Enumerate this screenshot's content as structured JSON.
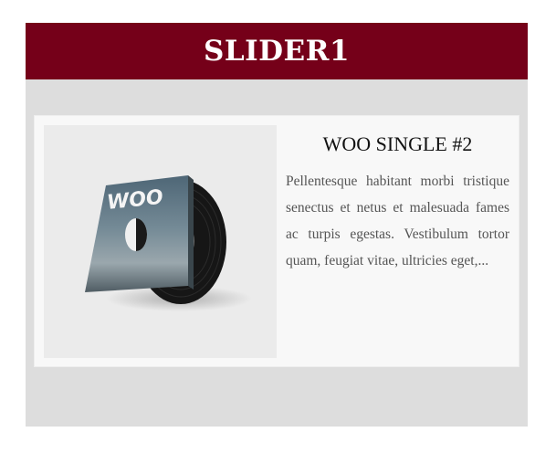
{
  "widget": {
    "title": "SLIDER1",
    "colors": {
      "header_bg": "#750019",
      "body_bg": "#dddddd",
      "slide_bg": "#f8f8f8"
    }
  },
  "slide": {
    "image": {
      "icon": "vinyl-record-album-image",
      "cover_text": "WOO"
    },
    "title": "WOO SINGLE #2",
    "excerpt": "Pellentesque habitant morbi tristique senectus et netus et malesuada fames ac turpis egestas. Vestibulum tortor quam, feugiat vitae, ultricies eget,..."
  }
}
